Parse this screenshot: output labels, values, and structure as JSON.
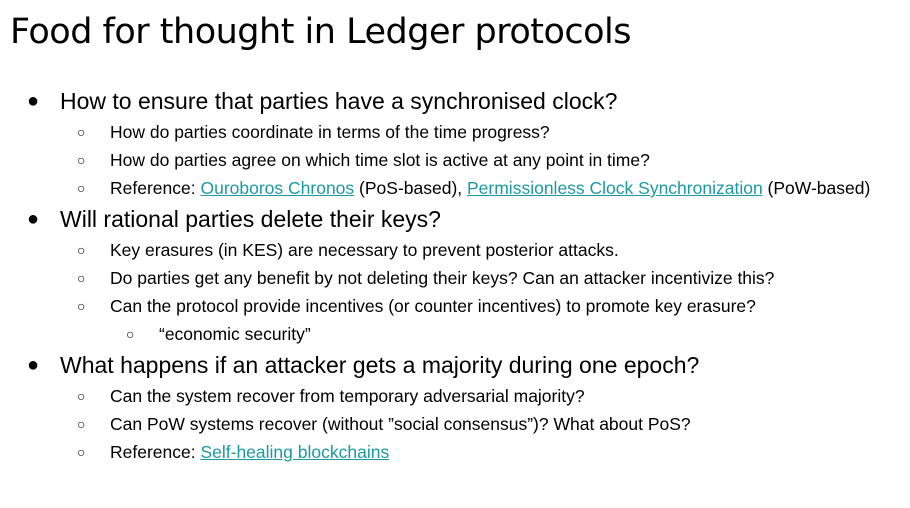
{
  "title": "Food for thought in Ledger protocols",
  "sections": [
    {
      "heading": "How to ensure that parties have a synchronised clock?",
      "items": [
        "How do parties coordinate in terms of the time progress?",
        "How do parties agree on which time slot is active at any point in time?"
      ],
      "reference": {
        "prefix": "Reference: ",
        "link1": "Ouroboros Chronos",
        "mid": " (PoS-based), ",
        "link2": "Permissionless Clock Synchronization",
        "suffix": " (PoW-based)"
      }
    },
    {
      "heading": "Will rational parties delete their keys?",
      "items": [
        "Key erasures (in KES) are necessary to prevent posterior attacks.",
        "Do parties get any benefit by not deleting their keys? Can an attacker incentivize this?",
        "Can the protocol provide incentives (or counter incentives) to promote key erasure?"
      ],
      "subitem": "“economic security”"
    },
    {
      "heading": "What happens if an attacker gets a majority during one epoch?",
      "items": [
        "Can the system recover from temporary adversarial majority?",
        "Can PoW systems recover (without ”social consensus”)? What about PoS?"
      ],
      "reference": {
        "prefix": "Reference: ",
        "link1": "Self-healing blockchains"
      }
    }
  ],
  "bullets": {
    "level1": "●",
    "level2": "○",
    "level3": "○"
  }
}
